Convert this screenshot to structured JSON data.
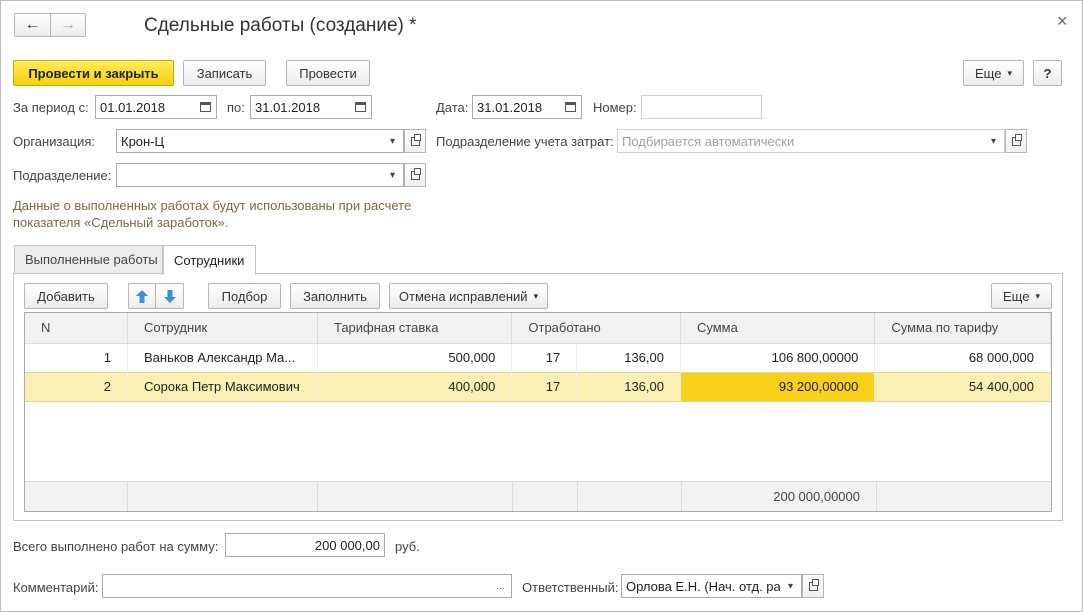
{
  "window": {
    "title": "Сдельные работы (создание) *",
    "close_symbol": "×"
  },
  "nav": {
    "back_symbol": "←",
    "forward_symbol": "→"
  },
  "toolbar": {
    "post_close": "Провести и закрыть",
    "save": "Записать",
    "post": "Провести",
    "more": "Еще",
    "help": "?"
  },
  "form": {
    "period_label": "За период с:",
    "period_from": "01.01.2018",
    "period_to_label": "по:",
    "period_to": "31.01.2018",
    "date_label": "Дата:",
    "date": "31.01.2018",
    "number_label": "Номер:",
    "number": "",
    "org_label": "Организация:",
    "org": "Крон-Ц",
    "cost_dept_label": "Подразделение учета затрат:",
    "cost_dept_placeholder": "Подбирается автоматически",
    "dept_label": "Подразделение:",
    "dept": "",
    "note_line1": "Данные о выполненных работах будут использованы при расчете",
    "note_line2": "показателя «Сдельный заработок»."
  },
  "tabs": [
    {
      "label": "Выполненные работы",
      "active": false
    },
    {
      "label": "Сотрудники",
      "active": true
    }
  ],
  "table_toolbar": {
    "add": "Добавить",
    "up_icon": "arrow-up-icon",
    "down_icon": "arrow-down-icon",
    "pick": "Подбор",
    "fill": "Заполнить",
    "cancel_corrections": "Отмена исправлений",
    "more": "Еще"
  },
  "table": {
    "columns": [
      "N",
      "Сотрудник",
      "Тарифная ставка",
      "Отработано",
      "Сумма",
      "Сумма по тарифу"
    ],
    "rows": [
      {
        "n": "1",
        "employee": "Ваньков Александр Ма...",
        "rate": "500,000",
        "days": "17",
        "hours": "136,00",
        "sum": "106 800,00000",
        "tariff_sum": "68 000,000"
      },
      {
        "n": "2",
        "employee": "Сорока Петр Максимович",
        "rate": "400,000",
        "days": "17",
        "hours": "136,00",
        "sum": "93 200,00000",
        "tariff_sum": "54 400,000"
      }
    ],
    "total_sum": "200 000,00000"
  },
  "totals": {
    "label": "Всего выполнено работ на сумму:",
    "value": "200 000,00",
    "currency": "руб."
  },
  "bottom": {
    "comment_label": "Комментарий:",
    "comment": "",
    "responsible_label": "Ответственный:",
    "responsible": "Орлова Е.Н. (Нач. отд. ра"
  },
  "colors": {
    "primary_button": "#f5d10a",
    "selected_row": "#fbf0b4",
    "current_cell": "#f9d11a",
    "note_text": "#7a6a40"
  }
}
